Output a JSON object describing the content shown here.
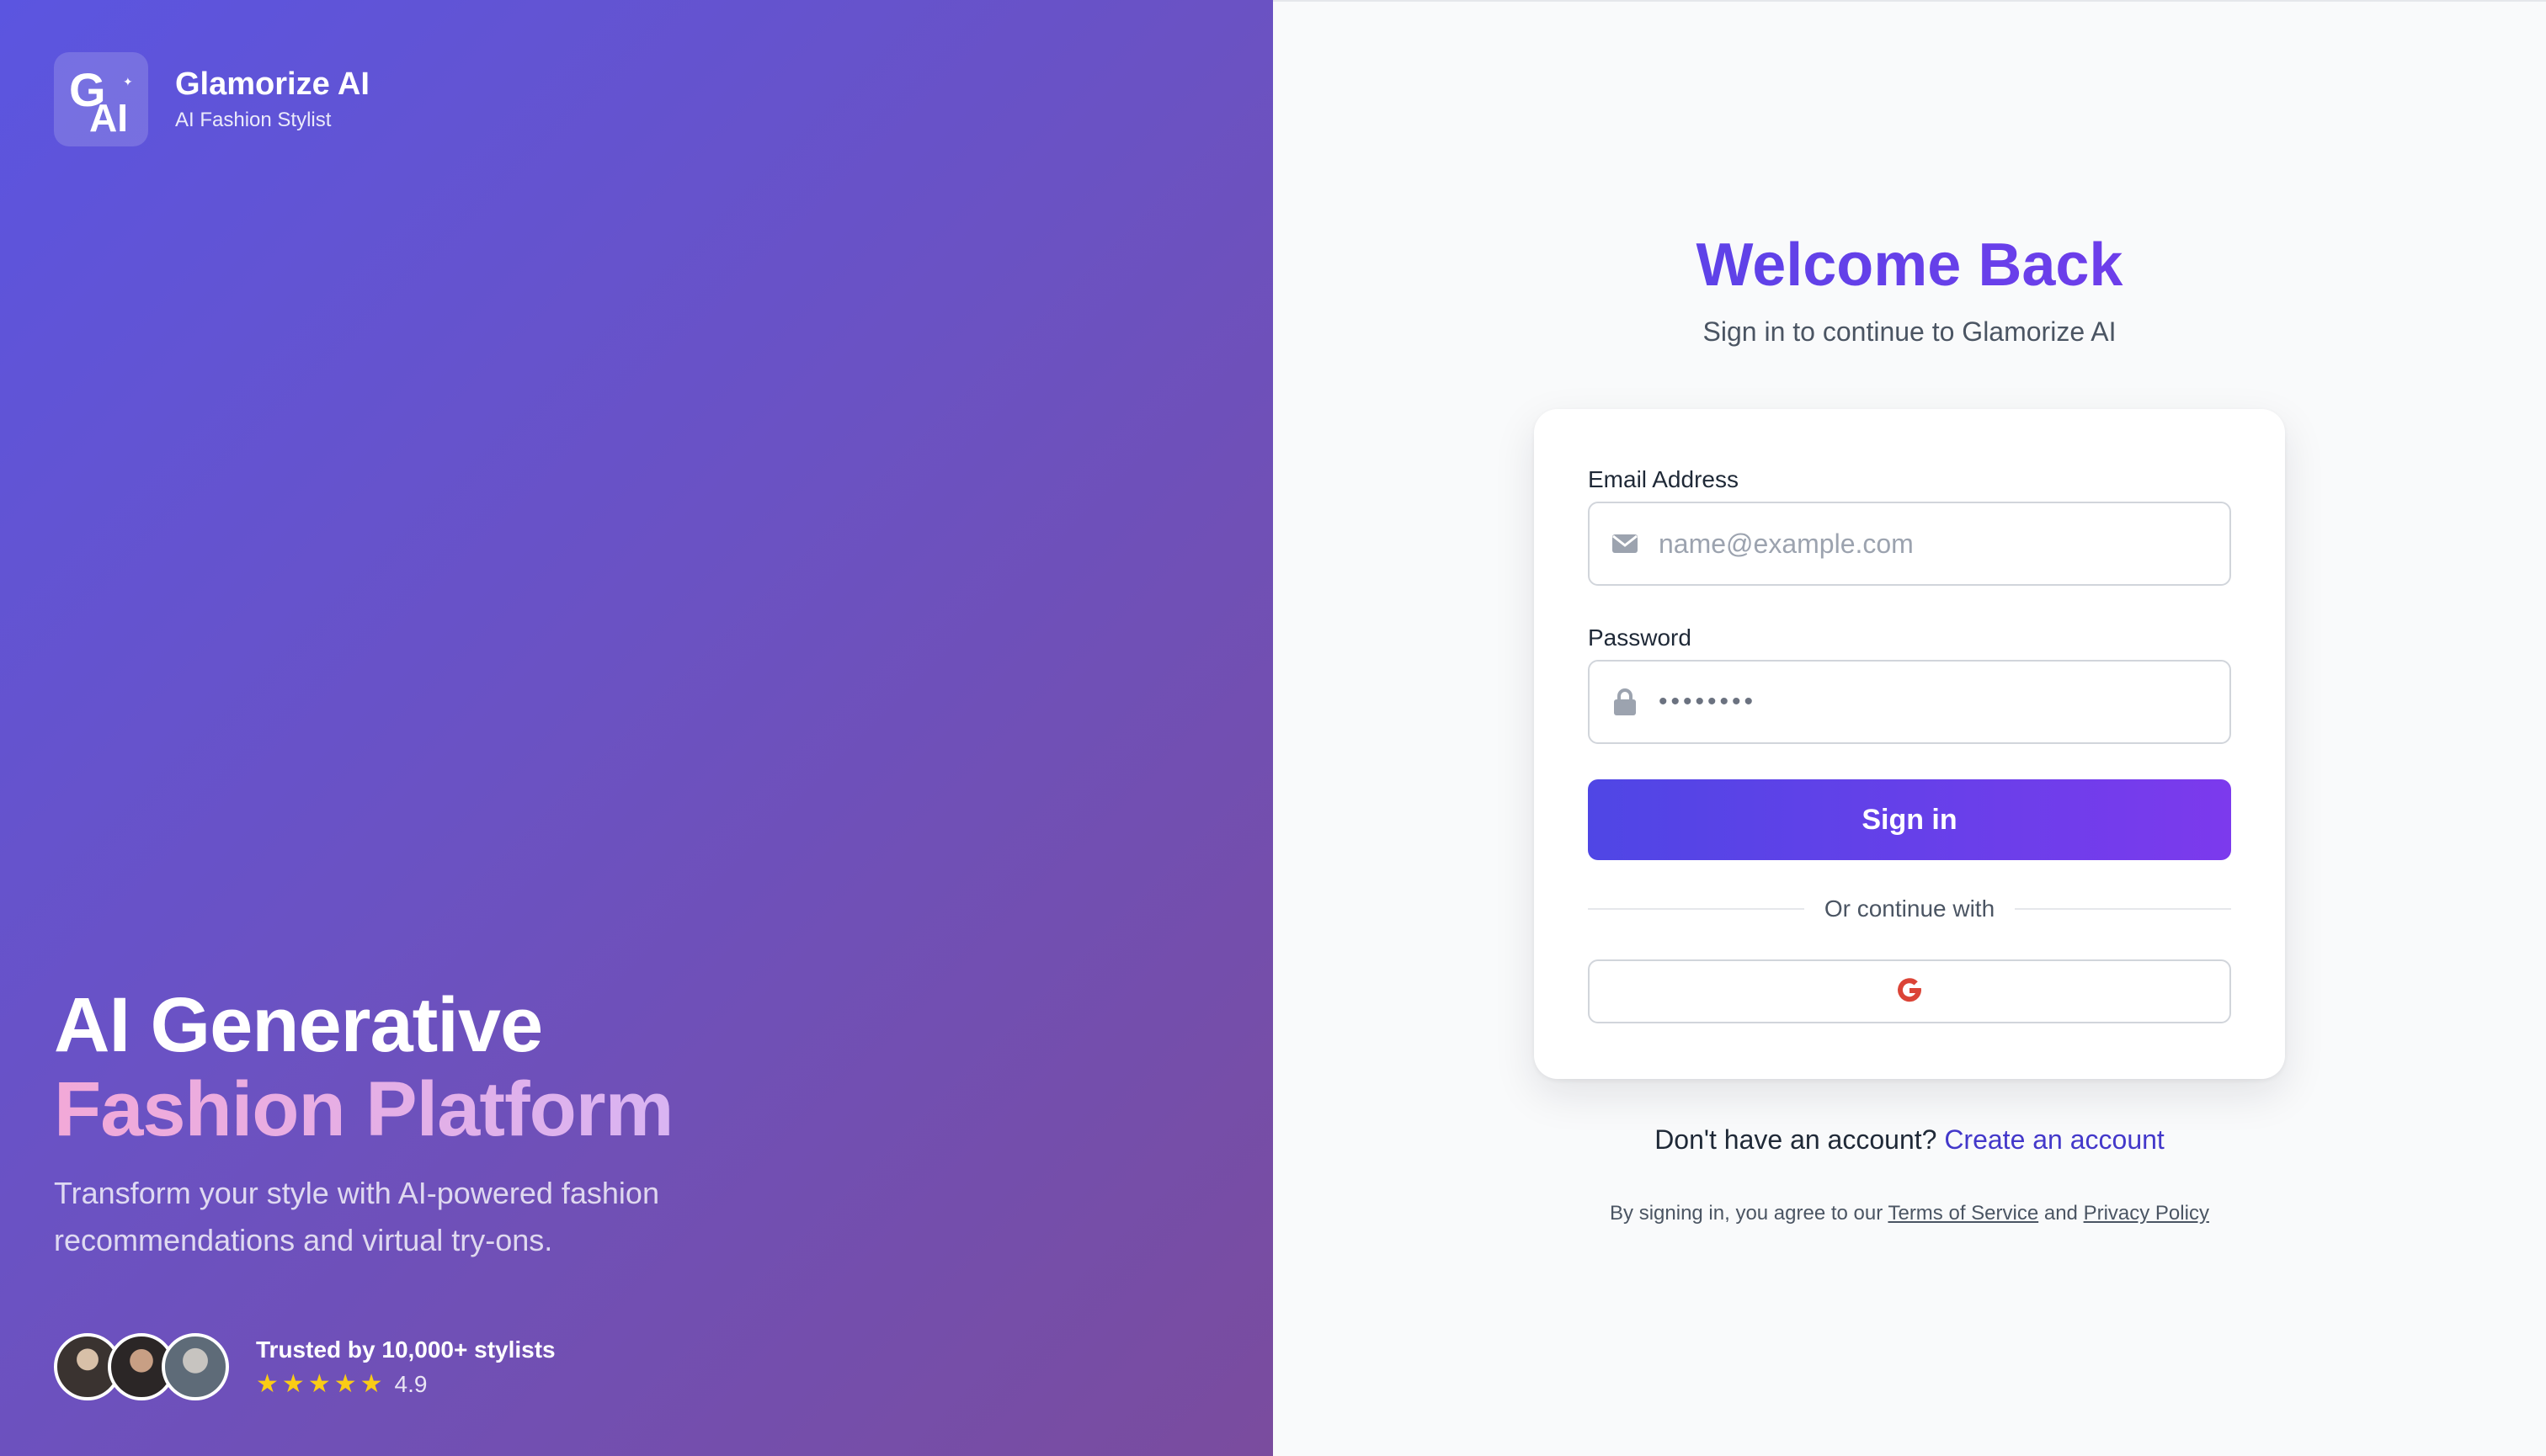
{
  "brand": {
    "logo_text": "GAI",
    "name": "Glamorize AI",
    "tagline": "AI Fashion Stylist"
  },
  "hero": {
    "title_line1": "AI Generative",
    "title_line2": "Fashion Platform",
    "subtitle": "Transform your style with AI-powered fashion recommendations and virtual try-ons.",
    "trust_text": "Trusted by 10,000+ stylists",
    "rating": "4.9",
    "stars": 5
  },
  "auth": {
    "heading": "Welcome Back",
    "subheading": "Sign in to continue to Glamorize AI",
    "email": {
      "label": "Email Address",
      "placeholder": "name@example.com",
      "icon": "envelope-icon"
    },
    "password": {
      "label": "Password",
      "masked_value": "••••••••",
      "icon": "lock-icon"
    },
    "signin_label": "Sign in",
    "divider_text": "Or continue with",
    "google_icon": "google-icon",
    "signup_prompt": "Don't have an account?",
    "signup_link": "Create an account",
    "legal_prefix": "By signing in, you agree to our",
    "terms_link": "Terms of Service",
    "legal_and": "and",
    "privacy_link": "Privacy Policy"
  },
  "colors": {
    "hero_gradient_start": "#5b55e0",
    "hero_gradient_end": "#7a4c9e",
    "accent_start": "#4f46e5",
    "accent_end": "#7c3aed",
    "star": "#facc15",
    "link": "#4338ca"
  }
}
